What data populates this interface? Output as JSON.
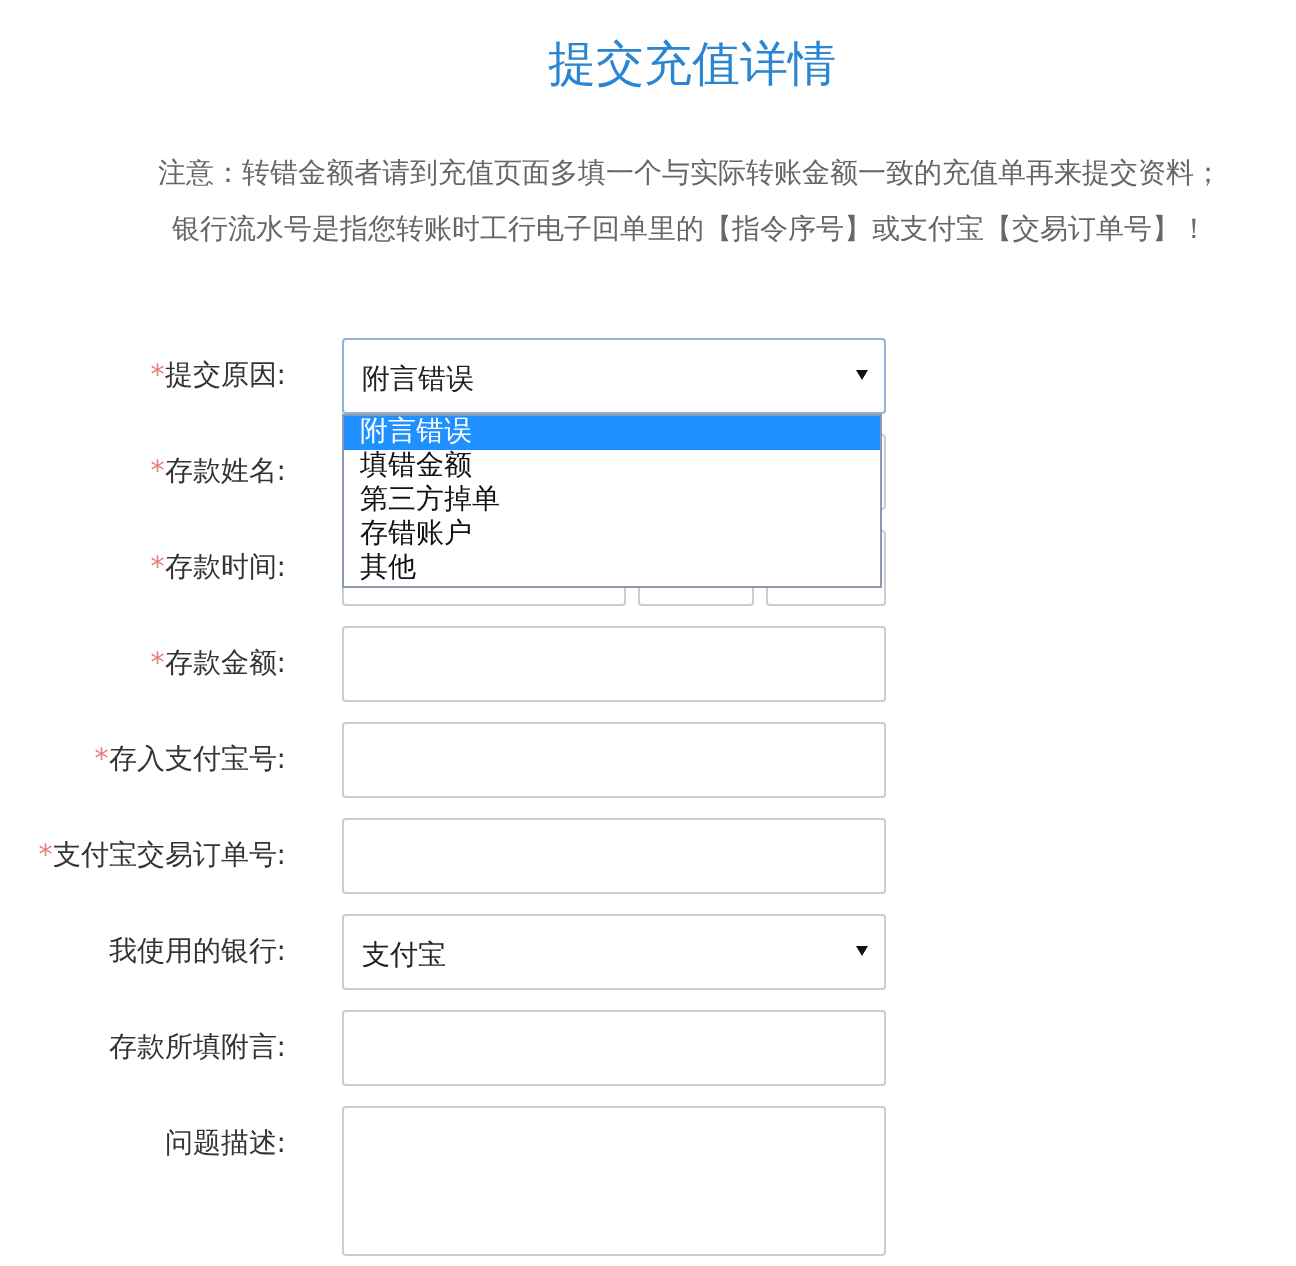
{
  "title": "提交充值详情",
  "notes": [
    "注意：转错金额者请到充值页面多填一个与实际转账金额一致的充值单再来提交资料；",
    "银行流水号是指您转账时工行电子回单里的【指令序号】或支付宝【交易订单号】！"
  ],
  "form": {
    "fields": [
      {
        "kind": "select",
        "required_mark": "*",
        "label": "提交原因:",
        "value": "附言错误",
        "focused": true,
        "expanded": true,
        "options": [
          {
            "label": "附言错误",
            "selected": true
          },
          {
            "label": "填错金额",
            "selected": false
          },
          {
            "label": "第三方掉单",
            "selected": false
          },
          {
            "label": "存错账户",
            "selected": false
          },
          {
            "label": "其他",
            "selected": false
          }
        ]
      },
      {
        "kind": "input",
        "required_mark": "*",
        "label": "存款姓名:",
        "focused": false
      },
      {
        "kind": "datetime",
        "required_mark": "*",
        "label": "存款时间:",
        "focused": false
      },
      {
        "kind": "input",
        "required_mark": "*",
        "label": "存款金额:",
        "focused": false
      },
      {
        "kind": "input",
        "required_mark": "*",
        "label": "存入支付宝号:",
        "focused": false
      },
      {
        "kind": "input",
        "required_mark": "*",
        "label": "支付宝交易订单号:",
        "focused": false
      },
      {
        "kind": "select",
        "label": "我使用的银行:",
        "value": "支付宝",
        "focused": false
      },
      {
        "kind": "input",
        "label": "存款所填附言:",
        "focused": false
      },
      {
        "kind": "textarea",
        "label": "问题描述:",
        "focused": false
      }
    ]
  }
}
